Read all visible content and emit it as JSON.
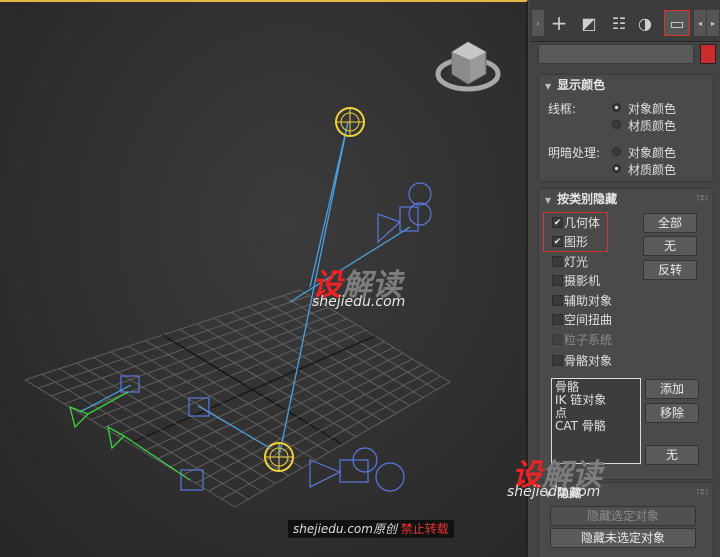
{
  "panel": {
    "tabs": [
      {
        "name": "create-tab",
        "glyph": "+"
      },
      {
        "name": "modify-tab",
        "glyph": "◩"
      },
      {
        "name": "hierarchy-tab",
        "glyph": "☷"
      },
      {
        "name": "motion-tab",
        "glyph": "◑"
      },
      {
        "name": "display-tab",
        "glyph": "▭"
      }
    ],
    "display_color": {
      "title": "显示颜色",
      "wireframe_label": "线框:",
      "shaded_label": "明暗处理:",
      "object_color": "对象颜色",
      "material_color": "材质颜色"
    },
    "hide_by_category": {
      "title": "按类别隐藏",
      "items": [
        {
          "label": "几何体",
          "checked": true
        },
        {
          "label": "图形",
          "checked": true
        },
        {
          "label": "灯光",
          "checked": false
        },
        {
          "label": "摄影机",
          "checked": false
        },
        {
          "label": "辅助对象",
          "checked": false
        },
        {
          "label": "空间扭曲",
          "checked": false
        },
        {
          "label": "粒子系统",
          "checked": false,
          "disabled": true
        },
        {
          "label": "骨骼对象",
          "checked": false
        }
      ],
      "all_button": "全部",
      "none_button": "无",
      "invert_button": "反转",
      "list": [
        "骨骼",
        "IK 链对象",
        "点",
        "CAT 骨骼"
      ],
      "add_button": "添加",
      "remove_button": "移除",
      "list_none_button": "无"
    },
    "hide": {
      "title": "隐藏",
      "hide_selected": "隐藏选定对象",
      "hide_unselected": "隐藏未选定对象"
    },
    "accent_color": "#cc2b2b"
  },
  "watermark": {
    "logo_she": "设",
    "logo_rest": "解读",
    "url": "shejiedu.com",
    "credit_site": "shejiedu.com原创",
    "credit_forbid": "禁止转载"
  }
}
